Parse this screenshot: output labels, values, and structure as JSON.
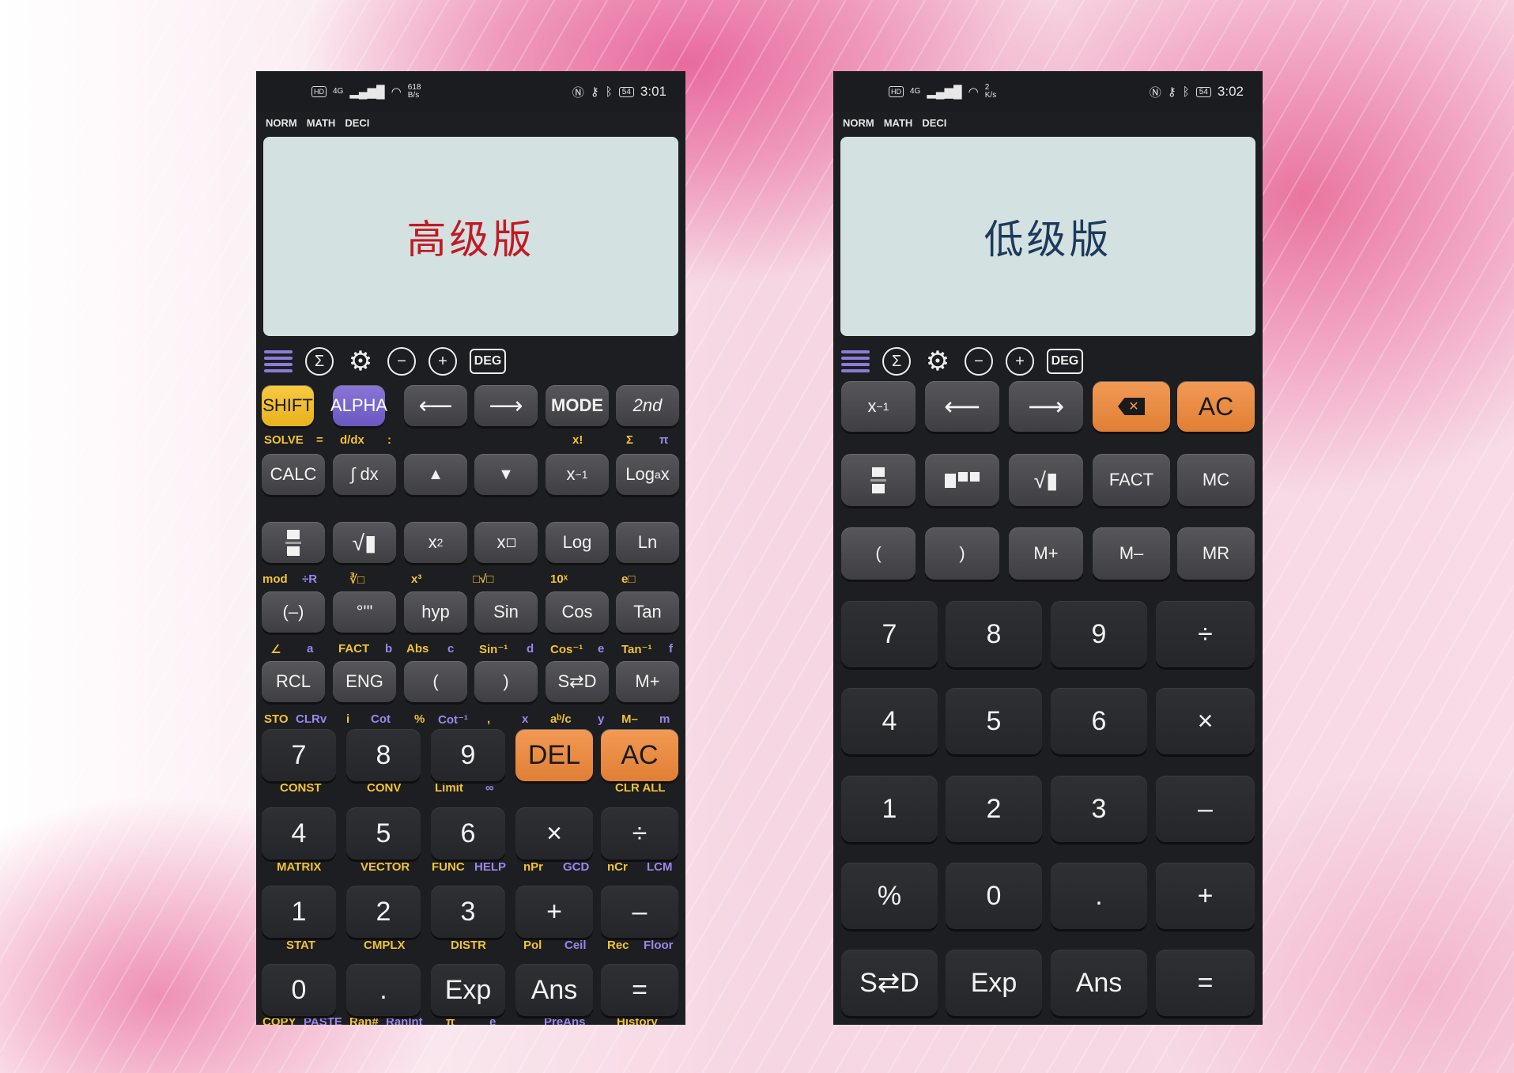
{
  "left_phone": {
    "status": {
      "hd": "HD",
      "net": "4G",
      "speed": "618",
      "speed_unit": "B/s",
      "battery": "54",
      "time": "3:01"
    },
    "modes": [
      "NORM",
      "MATH",
      "DECI"
    ],
    "display_text": "高级版",
    "toolbar": {
      "deg": "DEG"
    },
    "keys": {
      "shift": "SHIFT",
      "alpha": "ALPHA",
      "mode": "MODE",
      "second": "2nd",
      "calc": "CALC",
      "integral": "∫ dx",
      "log": "Log",
      "ln": "Ln",
      "neg": "(–)",
      "dms": "°'\"",
      "hyp": "hyp",
      "sin": "Sin",
      "cos": "Cos",
      "tan": "Tan",
      "rcl": "RCL",
      "eng": "ENG",
      "lparen": "(",
      "rparen": ")",
      "sd": "S⇄D",
      "mplus": "M+",
      "k7": "7",
      "k8": "8",
      "k9": "9",
      "del": "DEL",
      "ac": "AC",
      "k4": "4",
      "k5": "5",
      "k6": "6",
      "mul": "×",
      "div": "÷",
      "k1": "1",
      "k2": "2",
      "k3": "3",
      "plus": "+",
      "minus": "–",
      "k0": "0",
      "dot": ".",
      "exp": "Exp",
      "ans": "Ans",
      "eq": "="
    },
    "labels": {
      "r1": {
        "solve": "SOLVE",
        "eq": "=",
        "ddx": "d/dx",
        "colon": ":",
        "fact": "x!",
        "sigma": "Σ",
        "pi": "π"
      },
      "r2": {
        "mod": "mod",
        "divr": "÷R",
        "cbrt": "∛□",
        "cube": "x³",
        "xrt": "□√□",
        "ten": "10ˣ",
        "epow": "e□"
      },
      "r3": {
        "angle": "∠",
        "a": "a",
        "fact": "FACT",
        "b": "b",
        "abs": "Abs",
        "c": "c",
        "asin": "Sin⁻¹",
        "d": "d",
        "acos": "Cos⁻¹",
        "e": "e",
        "atan": "Tan⁻¹",
        "f": "f"
      },
      "r4": {
        "sto": "STO",
        "clrv": "CLRv",
        "i": "i",
        "cot": "Cot",
        "pct": "%",
        "acot": "Cot⁻¹",
        "comma": ",",
        "x": "x",
        "abc": "aᵇ/c",
        "y": "y",
        "mminus": "M–",
        "m": "m"
      },
      "r5": {
        "const": "CONST",
        "conv": "CONV",
        "limit": "Limit",
        "inf": "∞",
        "clrall": "CLR ALL"
      },
      "r6": {
        "matrix": "MATRIX",
        "vector": "VECTOR",
        "func": "FUNC",
        "help": "HELP",
        "npr": "nPr",
        "gcd": "GCD",
        "ncr": "nCr",
        "lcm": "LCM"
      },
      "r7": {
        "stat": "STAT",
        "cmplx": "CMPLX",
        "distr": "DISTR",
        "pol": "Pol",
        "ceil": "Ceil",
        "rec": "Rec",
        "floor": "Floor"
      },
      "r8": {
        "copy": "COPY",
        "paste": "PASTE",
        "ran": "Ran#",
        "ranint": "RanInt",
        "pi": "π",
        "e": "e",
        "preans": "PreAns",
        "history": "History"
      }
    }
  },
  "right_phone": {
    "status": {
      "hd": "HD",
      "net": "4G",
      "speed": "2",
      "speed_unit": "K/s",
      "battery": "54",
      "time": "3:02"
    },
    "modes": [
      "NORM",
      "MATH",
      "DECI"
    ],
    "display_text": "低级版",
    "toolbar": {
      "deg": "DEG"
    },
    "keys": {
      "ac": "AC",
      "fact": "FACT",
      "mc": "MC",
      "lparen": "(",
      "rparen": ")",
      "mplus": "M+",
      "mminus": "M–",
      "mr": "MR",
      "k7": "7",
      "k8": "8",
      "k9": "9",
      "div": "÷",
      "k4": "4",
      "k5": "5",
      "k6": "6",
      "mul": "×",
      "k1": "1",
      "k2": "2",
      "k3": "3",
      "minus": "–",
      "pct": "%",
      "k0": "0",
      "dot": ".",
      "plus": "+",
      "sd": "S⇄D",
      "exp": "Exp",
      "ans": "Ans",
      "eq": "="
    }
  }
}
